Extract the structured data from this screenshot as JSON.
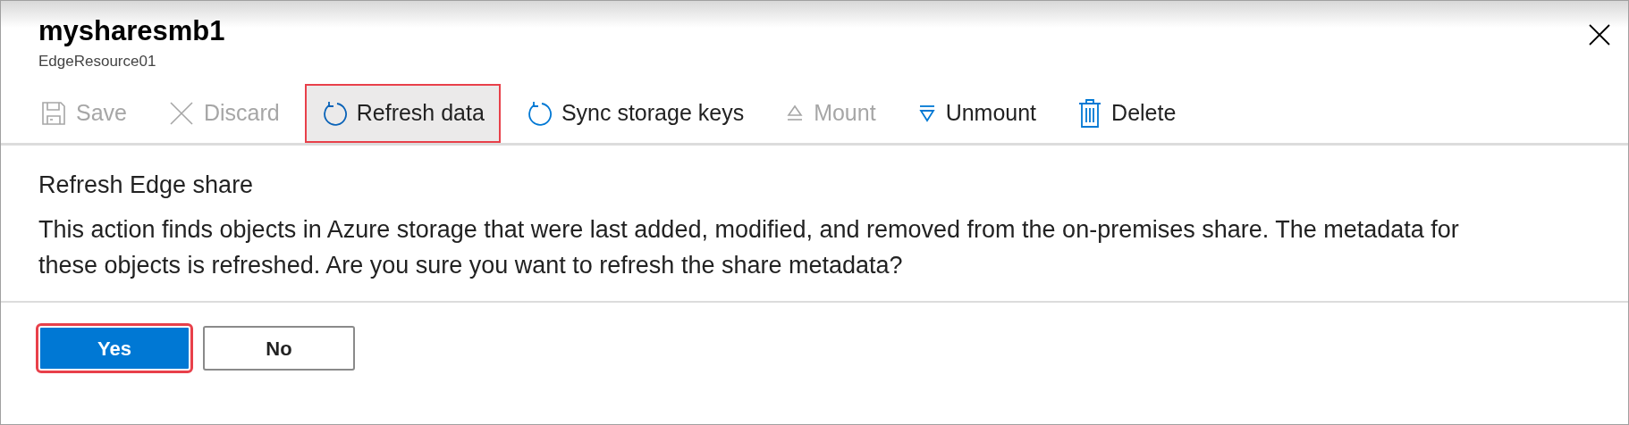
{
  "header": {
    "title": "mysharesmb1",
    "subtitle": "EdgeResource01"
  },
  "toolbar": [
    {
      "label": "Save",
      "kind": "save",
      "disabled": true,
      "highlighted": false
    },
    {
      "label": "Discard",
      "kind": "discard",
      "disabled": true,
      "highlighted": false
    },
    {
      "label": "Refresh data",
      "kind": "refresh",
      "disabled": false,
      "highlighted": true
    },
    {
      "label": "Sync storage keys",
      "kind": "refresh",
      "disabled": false,
      "highlighted": false
    },
    {
      "label": "Mount",
      "kind": "mount",
      "disabled": true,
      "highlighted": false
    },
    {
      "label": "Unmount",
      "kind": "unmount",
      "disabled": false,
      "highlighted": false
    },
    {
      "label": "Delete",
      "kind": "delete",
      "disabled": false,
      "highlighted": false
    }
  ],
  "dialog": {
    "heading": "Refresh Edge share",
    "message": "This action finds objects in Azure storage that were last added, modified, and removed from the on-premises share. The metadata for these objects is refreshed. Are you sure you want to refresh the share metadata?"
  },
  "buttons": [
    {
      "label": "Yes",
      "kind": "primary",
      "highlighted": true
    },
    {
      "label": "No",
      "kind": "secondary",
      "highlighted": false
    }
  ]
}
